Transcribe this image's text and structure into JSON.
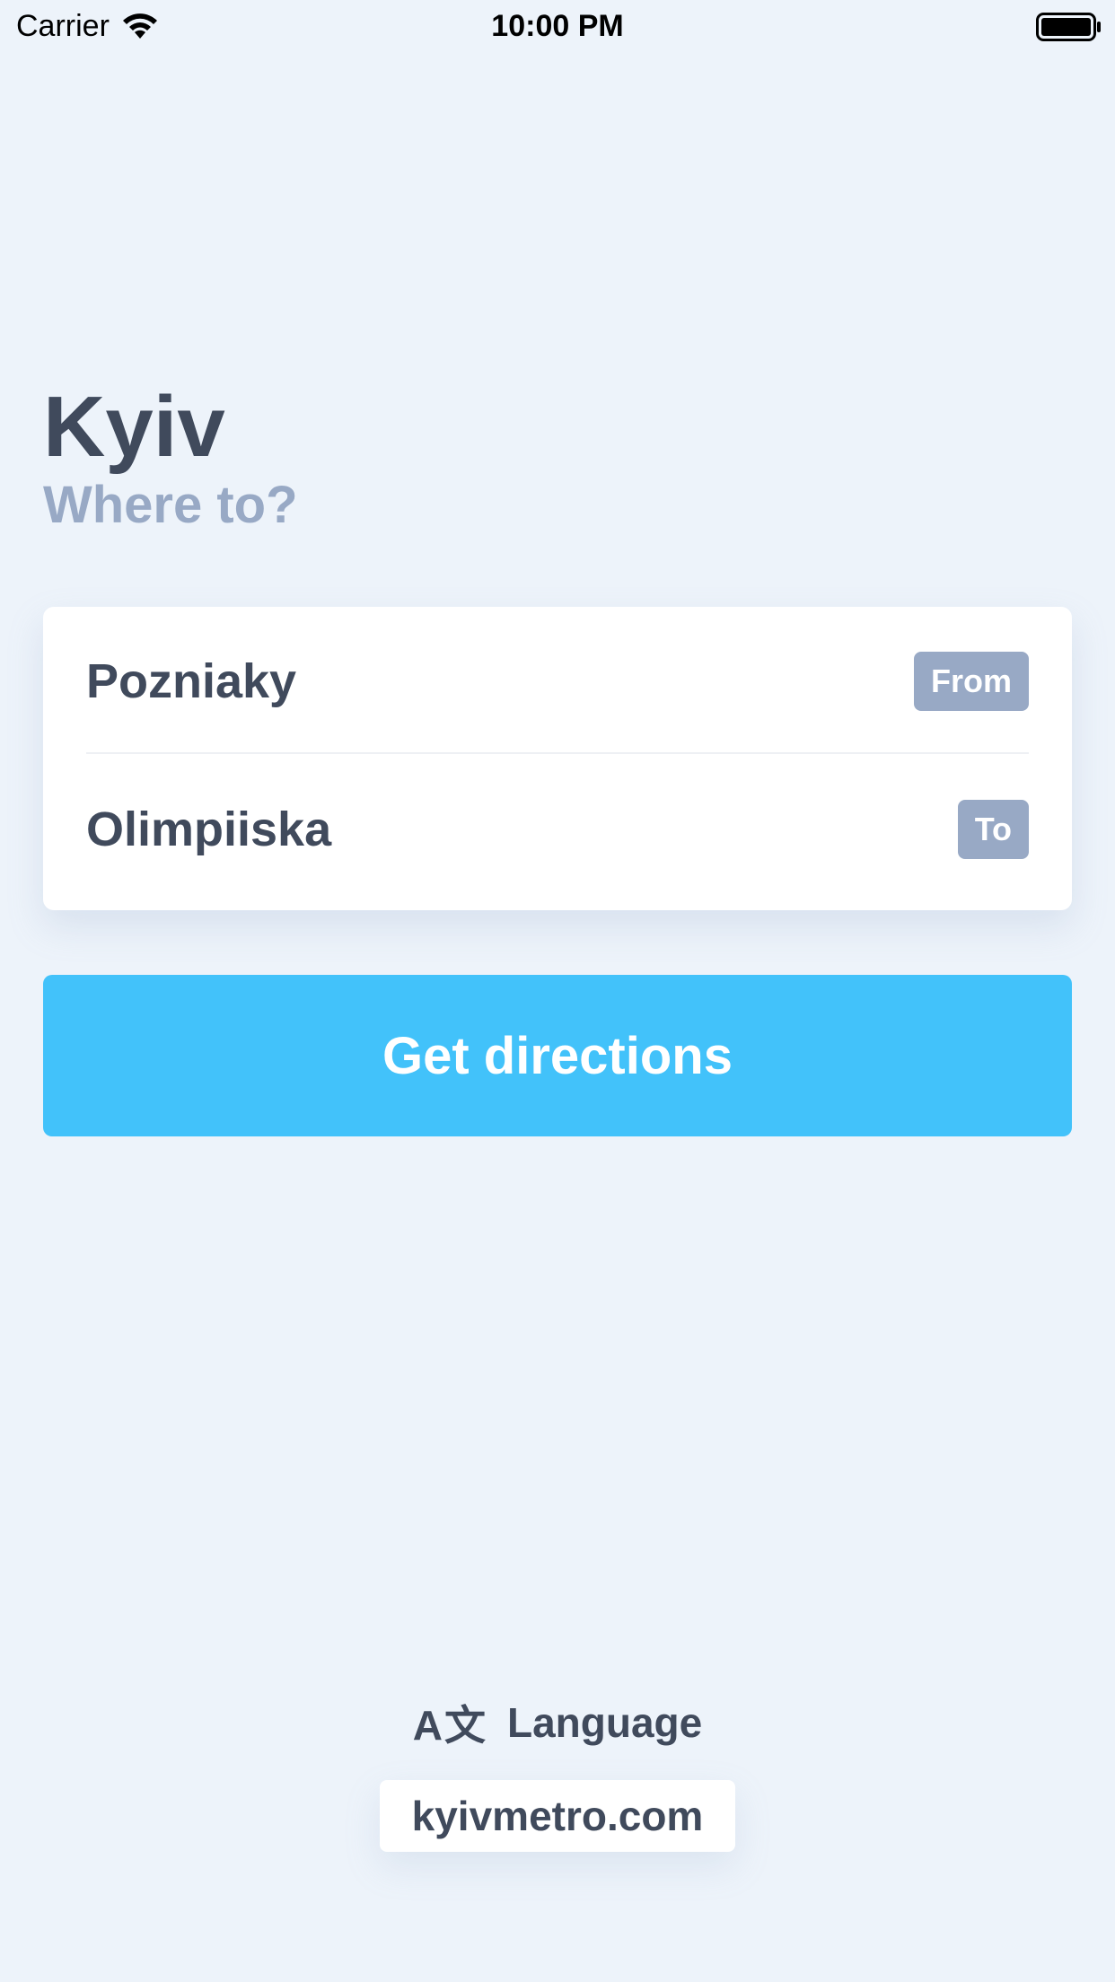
{
  "status_bar": {
    "carrier": "Carrier",
    "time": "10:00 PM"
  },
  "header": {
    "title": "Kyiv",
    "subtitle": "Where to?"
  },
  "route": {
    "from_station": "Pozniaky",
    "from_label": "From",
    "to_station": "Olimpiiska",
    "to_label": "To"
  },
  "cta": {
    "label": "Get directions"
  },
  "footer": {
    "language_icon": "translate-icon",
    "language_label": "Language",
    "website": "kyivmetro.com"
  },
  "colors": {
    "background": "#edf3fa",
    "text_dark": "#404a5c",
    "muted": "#98a9c5",
    "accent": "#42c2fa"
  }
}
